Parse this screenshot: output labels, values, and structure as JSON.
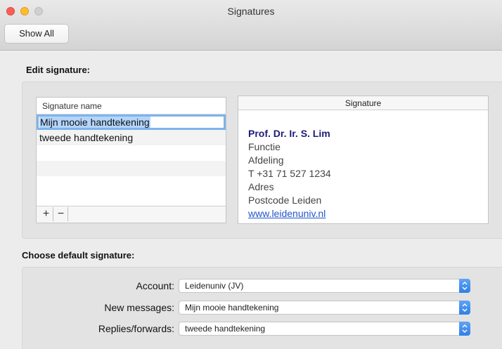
{
  "window": {
    "title": "Signatures",
    "show_all_label": "Show All"
  },
  "edit": {
    "section_title": "Edit signature:",
    "list_header": "Signature name",
    "signatures": [
      {
        "name": "Mijn mooie handtekening",
        "selected": true
      },
      {
        "name": "tweede handtekening",
        "selected": false
      }
    ],
    "add_label": "+",
    "remove_label": "−",
    "preview_header": "Signature",
    "preview_lines": {
      "name": "Prof. Dr. Ir. S. Lim",
      "line1": "Functie",
      "line2": "Afdeling",
      "line3": "T +31 71 527 1234",
      "line4": "Adres",
      "line5": "Postcode Leiden",
      "link": "www.leidenuniv.nl"
    }
  },
  "default": {
    "section_title": "Choose default signature:",
    "account_label": "Account:",
    "account_value": "Leidenuniv (JV)",
    "new_messages_label": "New messages:",
    "new_messages_value": "Mijn mooie handtekening",
    "replies_label": "Replies/forwards:",
    "replies_value": "tweede handtekening"
  },
  "colors": {
    "accent": "#2f7fe8",
    "signature_name": "#1b1b7a",
    "link": "#2255cc"
  }
}
